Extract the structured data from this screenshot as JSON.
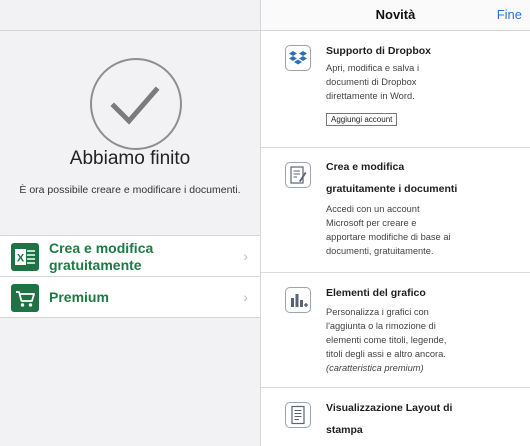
{
  "left": {
    "title": "Abbiamo finito",
    "subtitle": "È ora possibile creare e modificare i documenti.",
    "menu": [
      {
        "line1": "Crea e modifica",
        "line2": "gratuitamente",
        "icon": "excel-icon"
      },
      {
        "line1": "Premium",
        "line2": "",
        "icon": "cart-icon"
      }
    ]
  },
  "right": {
    "nav_title": "Novità",
    "done_label": "Fine",
    "features": [
      {
        "title_lines": [
          "Supporto di Dropbox"
        ],
        "body_lines": [
          "Apri, modifica e salva i",
          "documenti di Dropbox",
          "direttamente in Word."
        ],
        "button": "Aggiungi account",
        "icon": "dropbox-icon"
      },
      {
        "title_lines": [
          "Crea e modifica",
          "gratuitamente i documenti"
        ],
        "body_lines": [
          "Accedi con un account",
          "Microsoft per creare e",
          "apportare modifiche di base ai",
          "documenti, gratuitamente."
        ],
        "icon": "document-edit-icon"
      },
      {
        "title_lines": [
          "Elementi del grafico"
        ],
        "body_lines": [
          "Personalizza i grafici con",
          "l'aggiunta o la rimozione di",
          "elementi come titoli, legende,",
          "titoli degli assi e altro ancora.",
          "(caratteristica premium)"
        ],
        "icon": "chart-add-icon"
      },
      {
        "title_lines": [
          "Visualizzazione Layout di",
          "stampa"
        ],
        "body_lines": [],
        "icon": "page-layout-icon"
      }
    ]
  }
}
